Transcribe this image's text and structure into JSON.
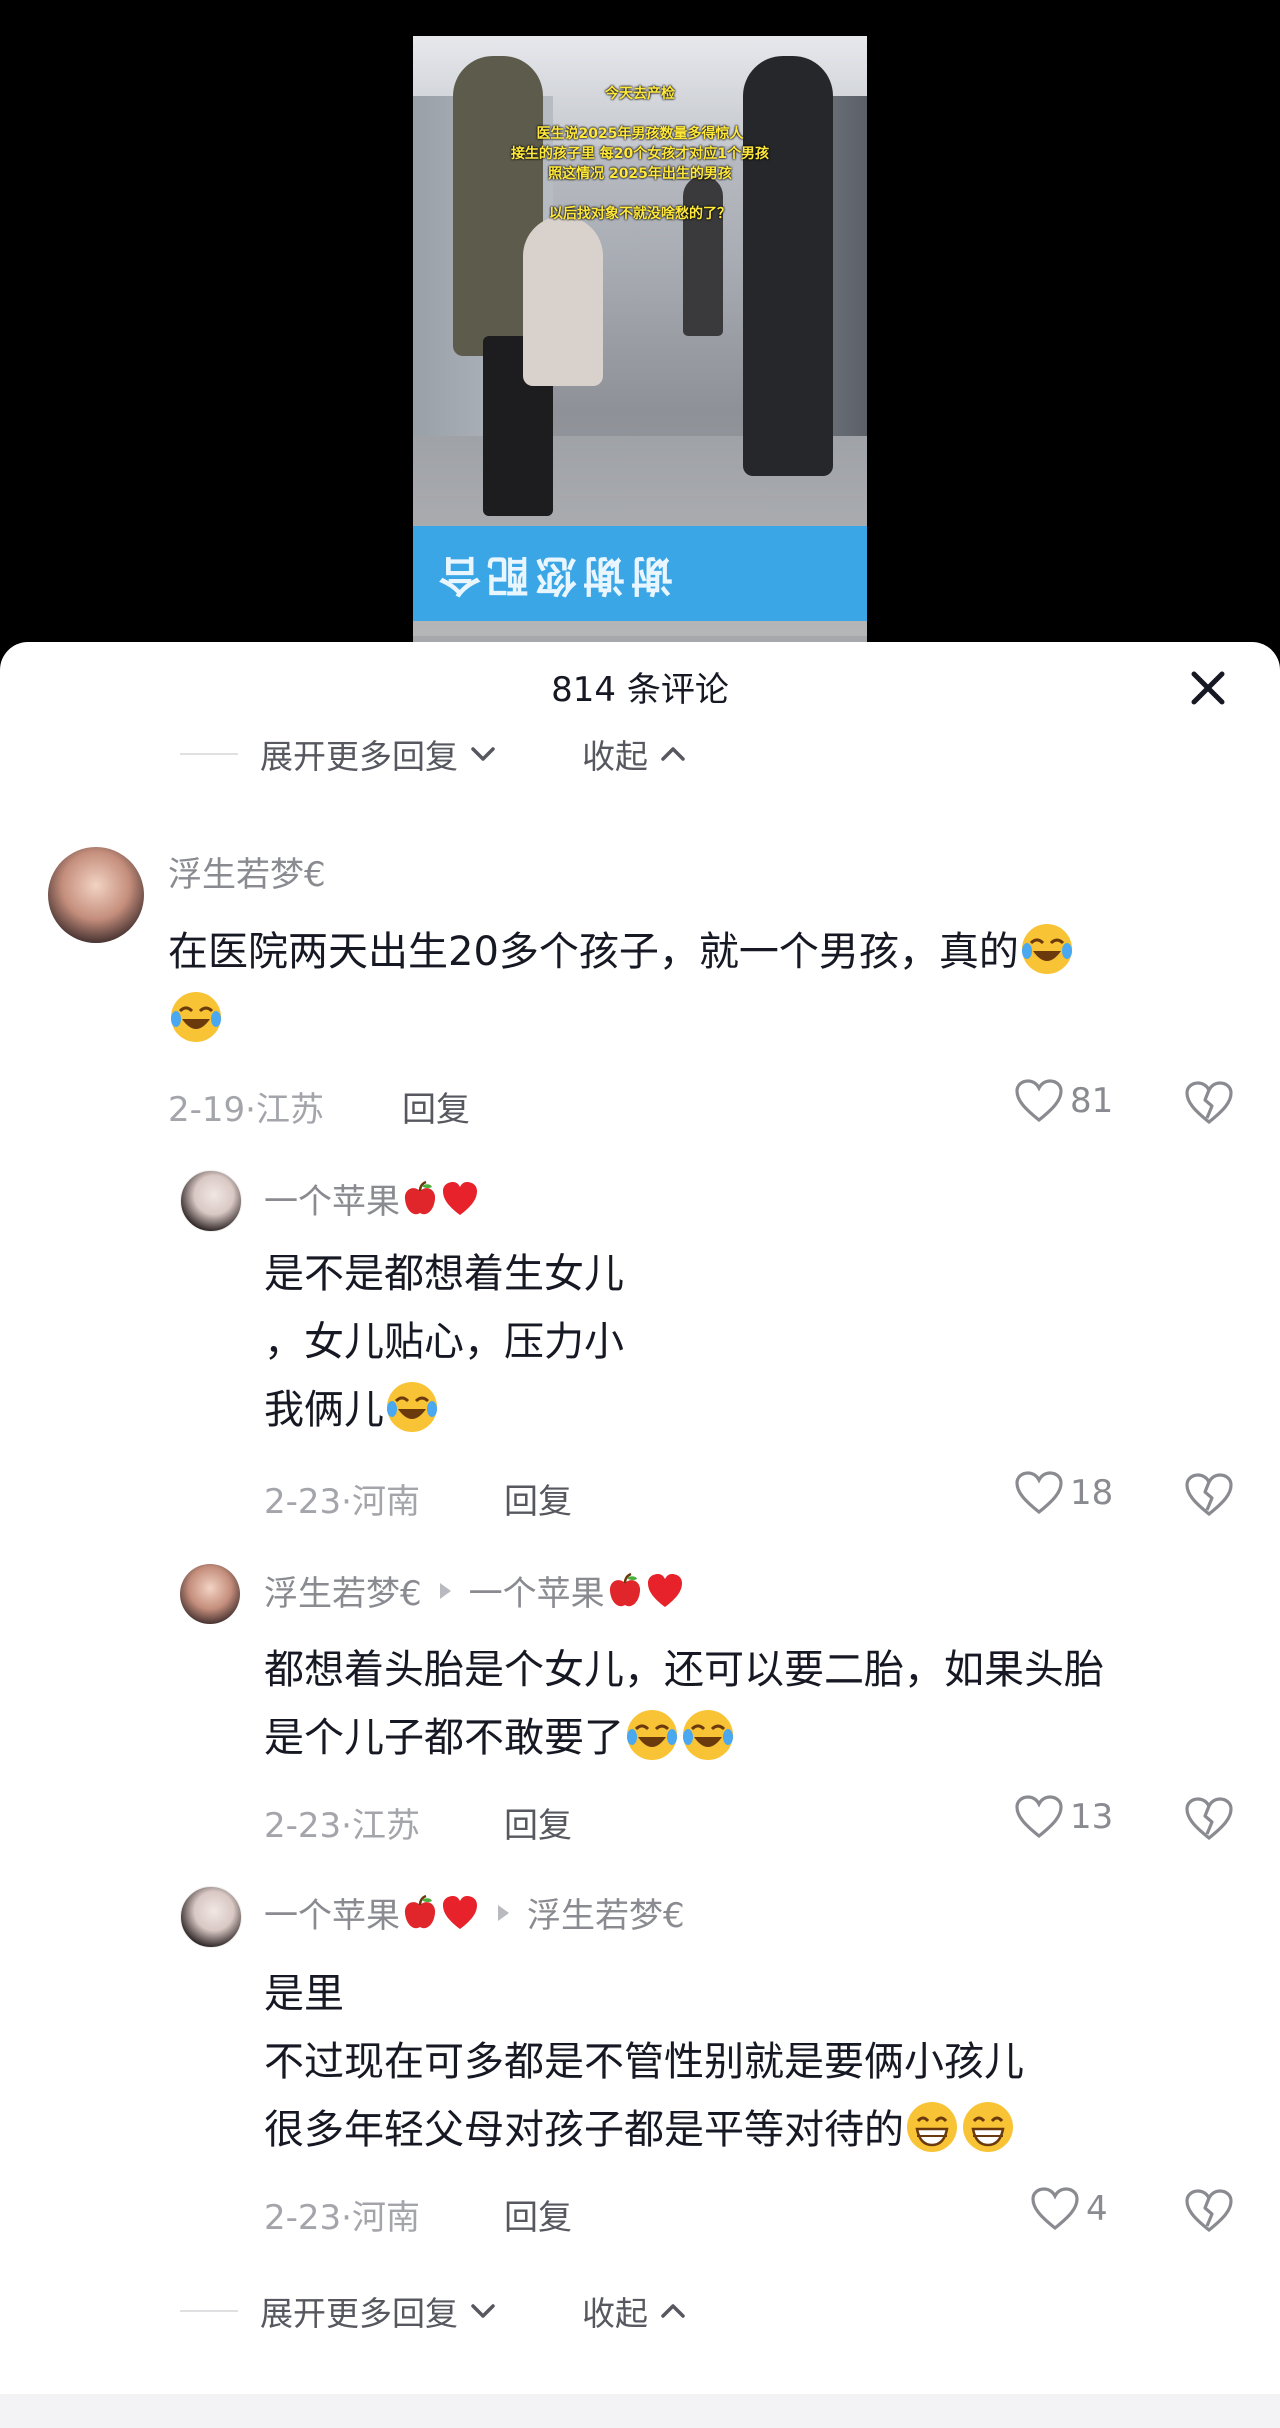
{
  "video": {
    "caption_lines": [
      "今天去产检",
      "",
      "医生说2025年男孩数量多得惊人",
      "接生的孩子里 每20个女孩才对应1个男孩",
      "照这情况 2025年出生的男孩",
      "",
      "以后找对象不就没啥愁的了？"
    ],
    "floor_sign": "谢谢您配合"
  },
  "sheet": {
    "title": "814 条评论",
    "close_icon": "close-icon"
  },
  "expand_top": {
    "more": "展开更多回复",
    "collapse": "收起"
  },
  "expand_bottom": {
    "more": "展开更多回复",
    "collapse": "收起"
  },
  "comments": [
    {
      "user": "浮生若梦€",
      "text_lines": [
        "在医院两天出生20多个孩子，就一个男孩，真的",
        ""
      ],
      "date": "2-19",
      "location": "江苏",
      "reply_label": "回复",
      "likes": "81"
    },
    {
      "user": "一个苹果",
      "text_lines": [
        "是不是都想着生女儿",
        "，女儿贴心，压力小",
        "我俩儿"
      ],
      "date": "2-23",
      "location": "河南",
      "reply_label": "回复",
      "likes": "18"
    },
    {
      "user": "浮生若梦€",
      "reply_to": "一个苹果",
      "text_lines": [
        "都想着头胎是个女儿，还可以要二胎，如果头胎",
        "是个儿子都不敢要了"
      ],
      "date": "2-23",
      "location": "江苏",
      "reply_label": "回复",
      "likes": "13"
    },
    {
      "user": "一个苹果",
      "reply_to": "浮生若梦€",
      "text_lines": [
        "是里",
        "不过现在可多都是不管性别就是要俩小孩儿",
        "很多年轻父母对孩子都是平等对待的"
      ],
      "date": "2-23",
      "location": "河南",
      "reply_label": "回复",
      "likes": "4"
    }
  ],
  "meta_separator": "·",
  "colors": {
    "accent_blue": "#3aa6e6",
    "caption_yellow": "#ffe83a",
    "text_primary": "#161823",
    "text_secondary": "#8a8b91"
  }
}
